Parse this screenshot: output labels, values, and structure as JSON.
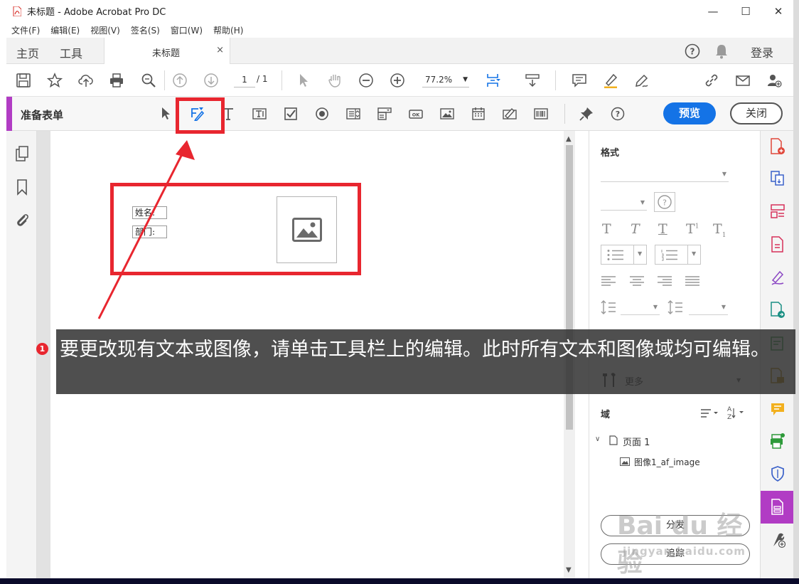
{
  "window": {
    "title": "未标题 - Adobe Acrobat Pro DC",
    "minimize": "—",
    "maximize": "☐",
    "close": "✕"
  },
  "menu": [
    "文件(F)",
    "编辑(E)",
    "视图(V)",
    "签名(S)",
    "窗口(W)",
    "帮助(H)"
  ],
  "tabs": {
    "home": "主页",
    "tools": "工具",
    "document": "未标题",
    "close_icon": "×",
    "login": "登录"
  },
  "toolbar": {
    "page_current": "1",
    "page_total": "/ 1",
    "zoom": "77.2%"
  },
  "form_bar": {
    "title": "准备表单",
    "preview_button": "预览",
    "close_button": "关闭"
  },
  "document": {
    "fields": [
      "姓名:",
      "部门:"
    ]
  },
  "right_panel": {
    "format_label": "格式",
    "more_label": "更多",
    "fields_label": "域",
    "tree_page": "页面 1",
    "tree_item": "图像1_af_image",
    "distribute_button": "分发",
    "track_button": "追踪"
  },
  "overlay": {
    "step_number": "1",
    "caption": "要更改现有文本或图像，请单击工具栏上的编辑。此时所有文本和图像域均可编辑。",
    "watermark_brand": "Bai du 经验",
    "watermark_url": "jingyan.baidu.com"
  },
  "colors": {
    "accent_purple": "#b13cc4",
    "primary_blue": "#1473e6",
    "annotation_red": "#e8262f"
  }
}
